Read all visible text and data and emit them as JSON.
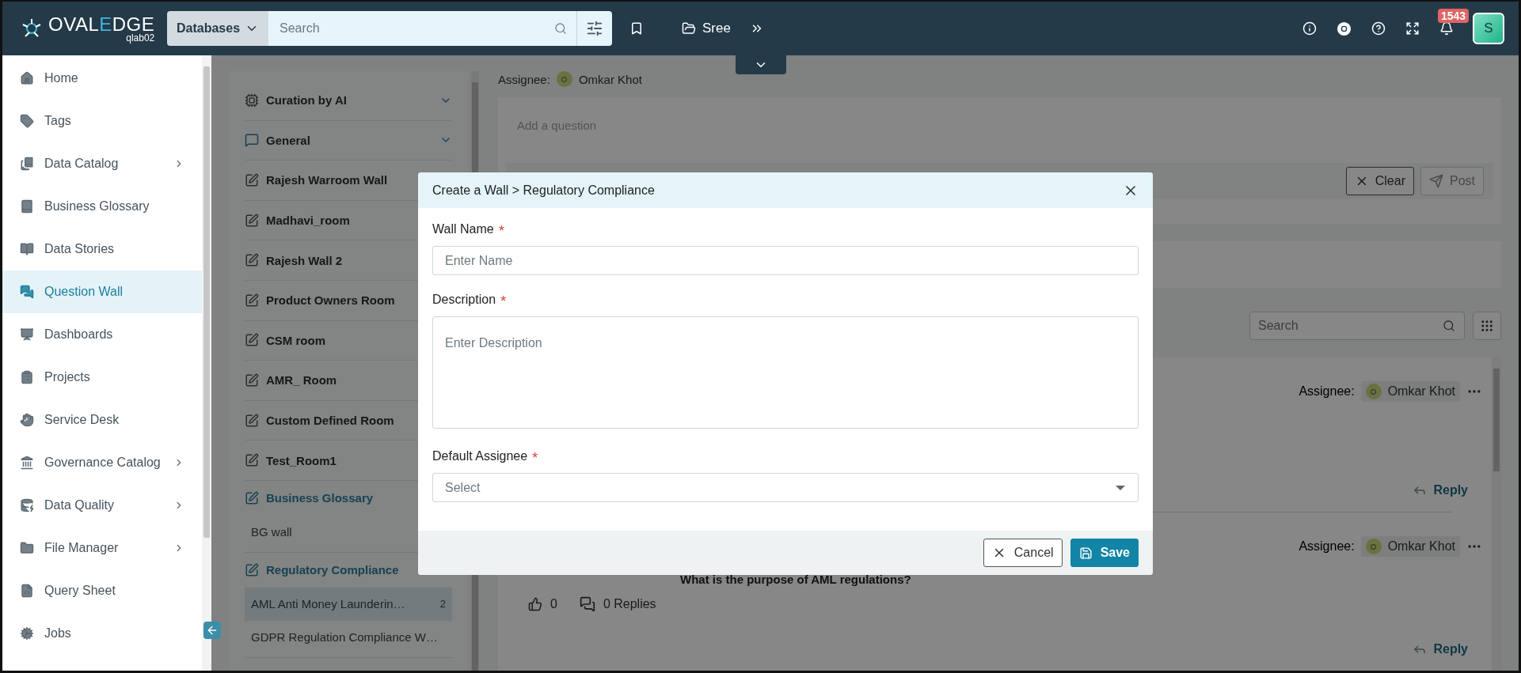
{
  "header": {
    "logo": {
      "parts": [
        "OVAL",
        "E",
        "DGE"
      ],
      "subtitle": "qlab02"
    },
    "search_scope": "Databases",
    "search": {
      "placeholder": "Search"
    },
    "breadcrumb": "Sree",
    "notifications_badge": "1543",
    "avatar": "S"
  },
  "sidebar": {
    "items": [
      {
        "label": "Home",
        "selected": false,
        "submenu": false
      },
      {
        "label": "Tags",
        "selected": false,
        "submenu": false
      },
      {
        "label": "Data Catalog",
        "selected": false,
        "submenu": true
      },
      {
        "label": "Business Glossary",
        "selected": false,
        "submenu": false
      },
      {
        "label": "Data Stories",
        "selected": false,
        "submenu": false
      },
      {
        "label": "Question Wall",
        "selected": true,
        "submenu": false
      },
      {
        "label": "Dashboards",
        "selected": false,
        "submenu": false
      },
      {
        "label": "Projects",
        "selected": false,
        "submenu": false
      },
      {
        "label": "Service Desk",
        "selected": false,
        "submenu": false
      },
      {
        "label": "Governance Catalog",
        "selected": false,
        "submenu": true
      },
      {
        "label": "Data Quality",
        "selected": false,
        "submenu": true
      },
      {
        "label": "File Manager",
        "selected": false,
        "submenu": true
      },
      {
        "label": "Query Sheet",
        "selected": false,
        "submenu": false
      },
      {
        "label": "Jobs",
        "selected": false,
        "submenu": false
      }
    ]
  },
  "walls": [
    {
      "kind": "group",
      "label": "Curation by AI",
      "expanded": false
    },
    {
      "kind": "group",
      "label": "General",
      "expanded": false
    },
    {
      "kind": "room",
      "label": "Rajesh Warroom Wall"
    },
    {
      "kind": "room",
      "label": "Madhavi_room"
    },
    {
      "kind": "room",
      "label": "Rajesh Wall 2"
    },
    {
      "kind": "room",
      "label": "Product Owners Room"
    },
    {
      "kind": "room",
      "label": "CSM room"
    },
    {
      "kind": "room",
      "label": "AMR_ Room"
    },
    {
      "kind": "room",
      "label": "Custom Defined Room"
    },
    {
      "kind": "room",
      "label": "Test_Room1"
    },
    {
      "kind": "category",
      "label": "Business Glossary",
      "children": [
        {
          "label": "BG wall",
          "selected": false
        }
      ]
    },
    {
      "kind": "category",
      "label": "Regulatory Compliance",
      "children": [
        {
          "label": "AML Anti Money Launderin…",
          "count": "2",
          "selected": true
        },
        {
          "label": "GDPR Regulation Compliance W…",
          "selected": false
        }
      ]
    }
  ],
  "wall_header": {
    "assignee_label": "Assignee:",
    "assignee": "Omkar Khot",
    "question": {
      "placeholder": "Add a question"
    },
    "buttons": [
      "Clear",
      "Post"
    ]
  },
  "questions_search": {
    "placeholder": "Search"
  },
  "posts": [
    {
      "assignee_label": "Assignee:",
      "assignee": "Omkar Khot",
      "reply": "Reply"
    },
    {
      "assignee_label": "Assignee:",
      "assignee": "Omkar Khot",
      "question": "What is the purpose of AML regulations?",
      "likes": "0",
      "replies": "0 Replies",
      "reply": "Reply"
    }
  ],
  "dialog": {
    "title": "Create a Wall > Regulatory Compliance",
    "fields": [
      {
        "kind": "input",
        "label": "Wall Name",
        "required_mark": "*",
        "placeholder": "Enter Name"
      },
      {
        "kind": "textarea",
        "label": "Description",
        "required_mark": "*",
        "placeholder": "Enter Description"
      },
      {
        "kind": "select",
        "label": "Default Assignee",
        "required_mark": "*",
        "placeholder": "Select"
      }
    ],
    "buttons": [
      {
        "kind": "secondary",
        "label": "Cancel"
      },
      {
        "kind": "primary",
        "label": "Save"
      }
    ]
  }
}
